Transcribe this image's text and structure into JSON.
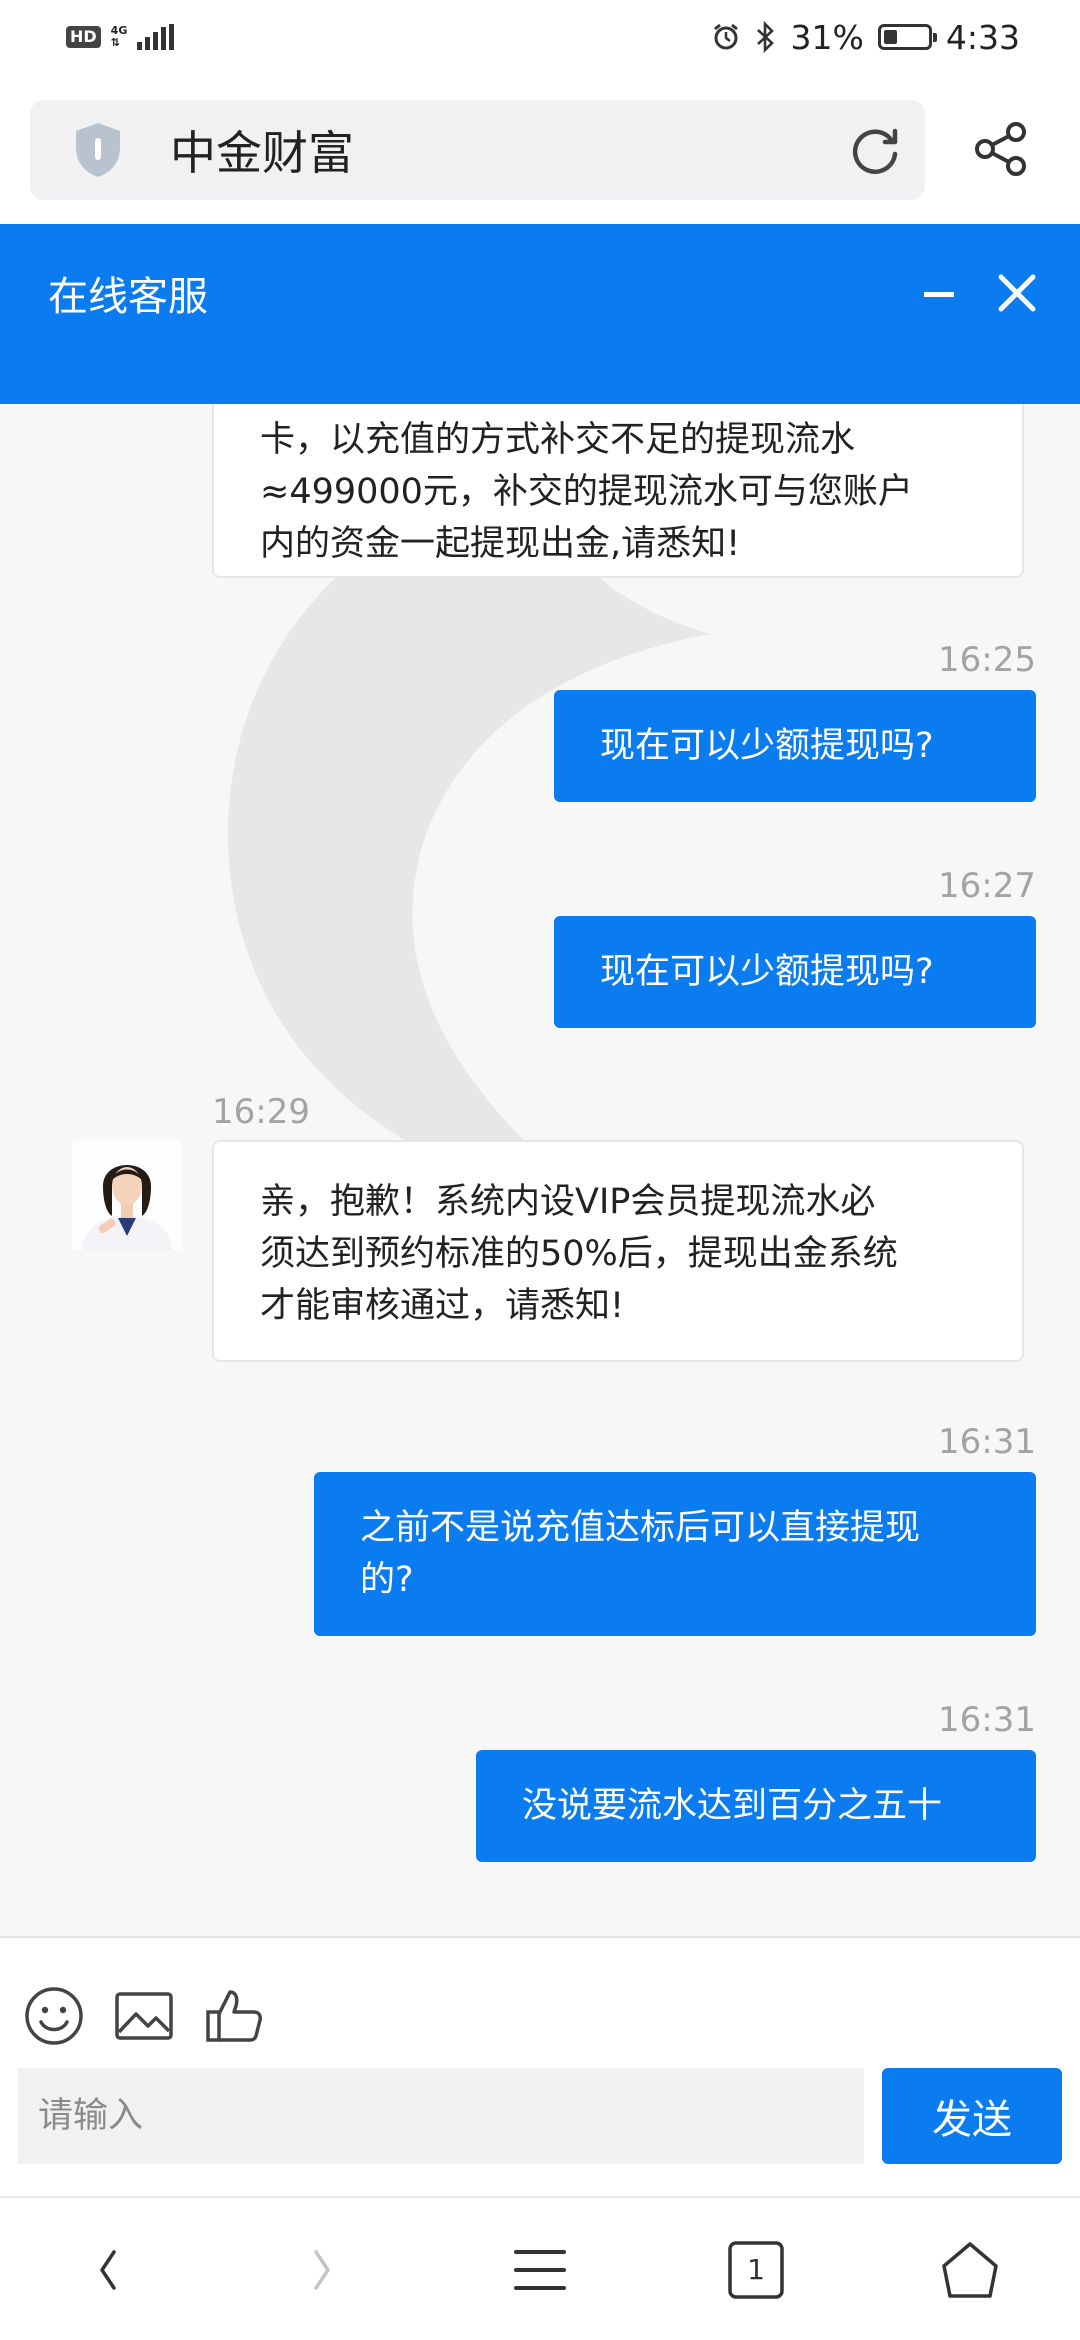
{
  "status_bar": {
    "hd": "HD",
    "network": "4G",
    "battery_pct": "31%",
    "battery_level": 0.31,
    "time": "4:33"
  },
  "browser": {
    "site_title": "中金财富",
    "icons": [
      "shield-icon",
      "reload-icon",
      "share-icon"
    ]
  },
  "chat_header": {
    "title": "在线客服",
    "icons": [
      "minimize-icon",
      "close-icon"
    ]
  },
  "messages": [
    {
      "from": "agent",
      "lines": [
        "卡，以充值的方式补交不足的提现流水",
        "≈499000元，补交的提现流水可与您账户",
        "内的资金一起提现出金,请悉知!"
      ]
    },
    {
      "from": "user",
      "time": "16:25",
      "lines": [
        "现在可以少额提现吗?"
      ]
    },
    {
      "from": "user",
      "time": "16:27",
      "lines": [
        "现在可以少额提现吗?"
      ]
    },
    {
      "from": "agent",
      "time": "16:29",
      "lines": [
        "亲，抱歉！系统内设VIP会员提现流水必",
        "须达到预约标准的50%后，提现出金系统",
        "才能审核通过，请悉知!"
      ]
    },
    {
      "from": "user",
      "time": "16:31",
      "lines": [
        "之前不是说充值达标后可以直接提现",
        "的?"
      ]
    },
    {
      "from": "user",
      "time": "16:31",
      "lines": [
        "没说要流水达到百分之五十"
      ]
    }
  ],
  "input": {
    "placeholder": "请输入",
    "send_label": "发送",
    "tools": [
      "emoji-icon",
      "image-icon",
      "thumbs-up-icon"
    ]
  },
  "nav": {
    "tab_count": "1",
    "icons": [
      "back-icon",
      "forward-icon",
      "menu-icon",
      "tabs-icon",
      "home-icon"
    ]
  },
  "colors": {
    "accent": "#0a7cf0",
    "bubble_in_bg": "#ffffff",
    "page_bg": "#f7f7f8",
    "timestamp": "#a3a3a3"
  }
}
